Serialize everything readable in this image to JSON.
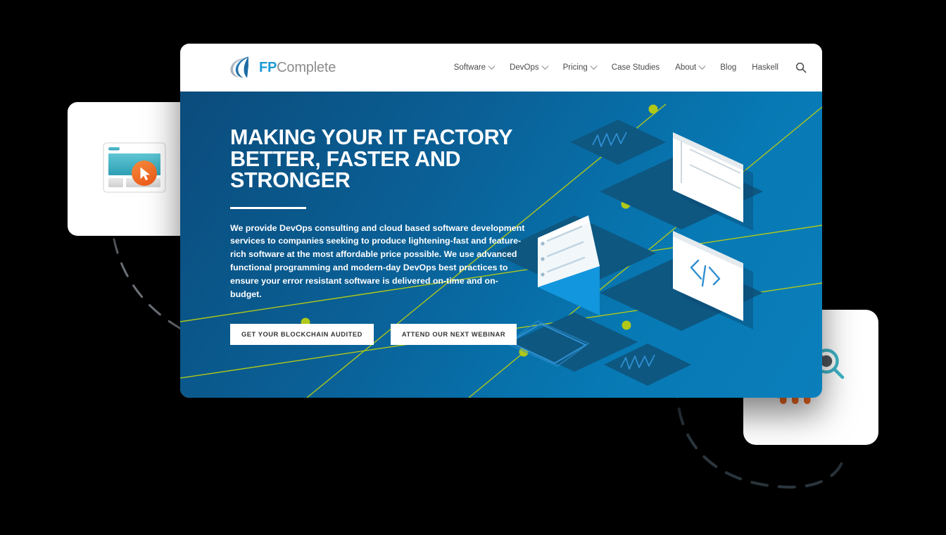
{
  "window": {
    "brand": {
      "fp": "FP",
      "complete": "Complete",
      "logo_icon": "fpcomplete-swoosh-logo"
    },
    "nav": [
      {
        "label": "Software",
        "has_dropdown": true,
        "icon": "chevron-down-icon"
      },
      {
        "label": "DevOps",
        "has_dropdown": true,
        "icon": "chevron-down-icon"
      },
      {
        "label": "Pricing",
        "has_dropdown": true,
        "icon": "chevron-down-icon"
      },
      {
        "label": "Case Studies",
        "has_dropdown": false,
        "icon": ""
      },
      {
        "label": "About",
        "has_dropdown": true,
        "icon": "chevron-down-icon"
      },
      {
        "label": "Blog",
        "has_dropdown": false,
        "icon": ""
      },
      {
        "label": "Haskell",
        "has_dropdown": false,
        "icon": ""
      }
    ],
    "search_icon": "search-icon"
  },
  "hero": {
    "headline": "Making Your IT Factory Better, Faster and Stronger",
    "lede": "We provide DevOps consulting and cloud based software development services to companies seeking to produce lightening-fast and feature-rich software at the most affordable price possible. We use advanced functional programming and modern-day DevOps best practices to ensure your error resistant software is delivered on-time and on-budget.",
    "cta_primary": "Get Your Blockchain Audited",
    "cta_secondary": "Attend Our Next Webinar",
    "illustration": "isometric-devops-platforms"
  },
  "floating_cards": [
    {
      "name": "browser-window-cursor-card",
      "icon": "browser-window-cursor-icon"
    },
    {
      "name": "analytics-growth-card",
      "icon": "analytics-magnifier-bars-icon"
    }
  ],
  "decorations": [
    {
      "name": "dashed-arc-left",
      "icon": "dashed-arc-icon"
    },
    {
      "name": "dashed-arc-right",
      "icon": "dashed-arc-icon"
    }
  ],
  "colors": {
    "hero_dark": "#0b4c7c",
    "hero_light": "#0b7fbb",
    "platform": "#0d5781",
    "accent_lime": "#b0c818",
    "brand_blue": "#1c9ad6",
    "brand_gray": "#8c8c8c",
    "orange": "#f26722",
    "teal": "#3fb6c8",
    "background": "#000000",
    "card_white": "#ffffff"
  }
}
